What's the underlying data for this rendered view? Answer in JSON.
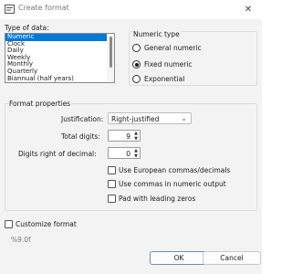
{
  "window": {
    "title": "Create format",
    "close_glyph": "✕"
  },
  "type_of_data": {
    "label": "Type of data:",
    "items": [
      {
        "label": "Numeric",
        "selected": true
      },
      {
        "label": "Clock",
        "selected": false
      },
      {
        "label": "Daily",
        "selected": false
      },
      {
        "label": "Weekly",
        "selected": false
      },
      {
        "label": "Monthly",
        "selected": false
      },
      {
        "label": "Quarterly",
        "selected": false
      },
      {
        "label": "Biannual (half years)",
        "selected": false
      }
    ]
  },
  "numeric_type": {
    "label": "Numeric type",
    "options": [
      {
        "label": "General numeric",
        "checked": false
      },
      {
        "label": "Fixed numeric",
        "checked": true
      },
      {
        "label": "Exponential",
        "checked": false
      }
    ]
  },
  "format_properties": {
    "label": "Format properties",
    "justification_label": "Justification:",
    "justification_value": "Right-justified",
    "total_digits_label": "Total digits:",
    "total_digits_value": "9",
    "digits_right_label": "Digits right of decimal:",
    "digits_right_value": "0",
    "european_commas_label": "Use European commas/decimals",
    "commas_numeric_label": "Use commas in numeric output",
    "pad_zeros_label": "Pad with leading zeros"
  },
  "customize": {
    "label": "Customize format",
    "format_string": "%9.0f"
  },
  "buttons": {
    "ok": "OK",
    "cancel": "Cancel"
  },
  "colors": {
    "selection": "#0078d7",
    "primary_border": "#6a8fbf"
  },
  "icons": [
    "app-icon",
    "close-icon",
    "chevron-down-icon",
    "spin-up-icon",
    "spin-down-icon"
  ]
}
